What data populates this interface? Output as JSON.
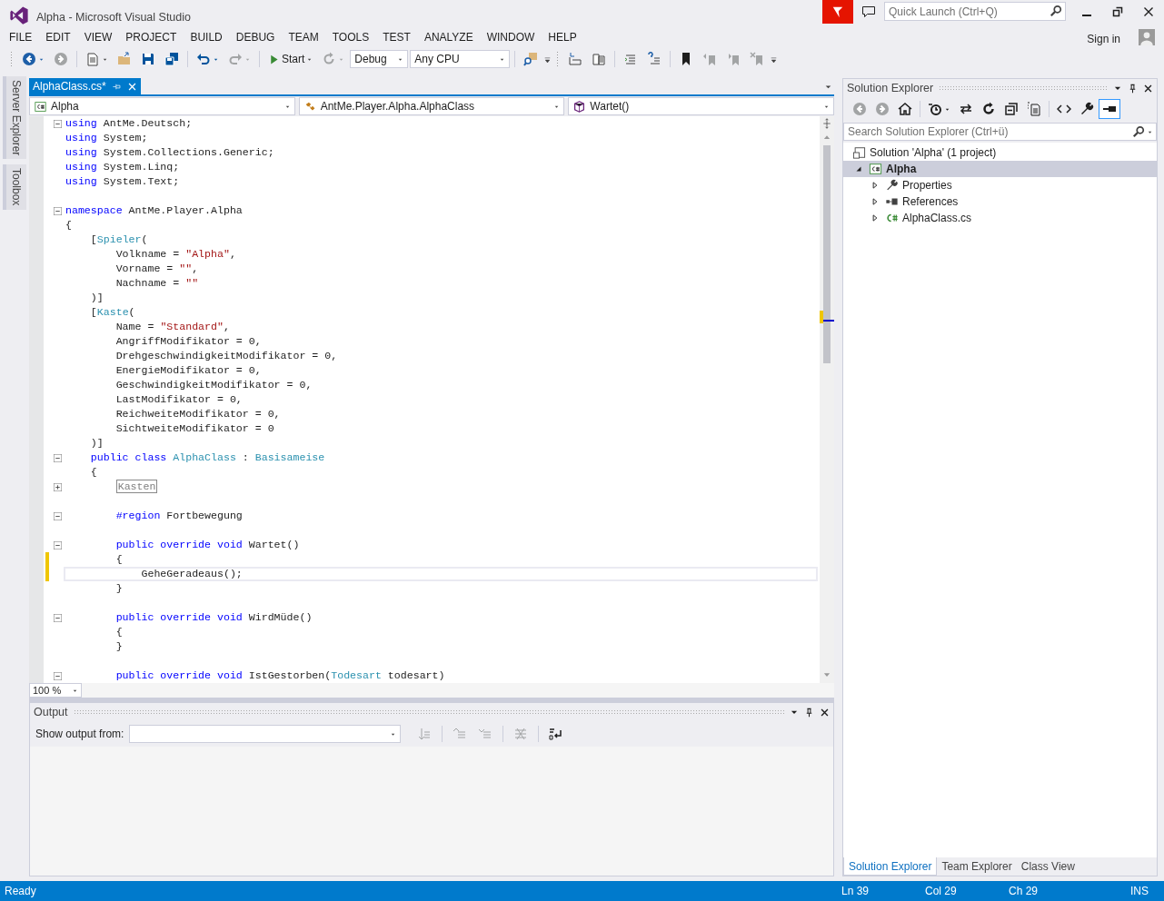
{
  "window": {
    "title": "Alpha - Microsoft Visual Studio",
    "quick_launch": {
      "placeholder": "Quick Launch (Ctrl+Q)"
    },
    "sign_in": "Sign in"
  },
  "menu": [
    "FILE",
    "EDIT",
    "VIEW",
    "PROJECT",
    "BUILD",
    "DEBUG",
    "TEAM",
    "TOOLS",
    "TEST",
    "ANALYZE",
    "WINDOW",
    "HELP"
  ],
  "toolbar": [
    {
      "kind": "grip"
    },
    {
      "kind": "back",
      "disabled": false,
      "dropdown": true
    },
    {
      "kind": "forward",
      "disabled": true,
      "dropdown": false
    },
    {
      "kind": "separator"
    },
    {
      "kind": "new-project",
      "disabled": false,
      "dropdown": true
    },
    {
      "kind": "open",
      "disabled": false,
      "dropdown": false
    },
    {
      "kind": "save",
      "disabled": false,
      "dropdown": false
    },
    {
      "kind": "save-all",
      "disabled": false,
      "dropdown": false
    },
    {
      "kind": "separator"
    },
    {
      "kind": "undo",
      "disabled": false,
      "dropdown": true
    },
    {
      "kind": "redo",
      "disabled": true,
      "dropdown": true
    },
    {
      "kind": "separator"
    },
    {
      "kind": "start",
      "label": "Start",
      "dropdown": true
    },
    {
      "kind": "restart",
      "disabled": true,
      "dropdown": true
    },
    {
      "kind": "combo",
      "value": "Debug"
    },
    {
      "kind": "combo",
      "value": "Any CPU"
    },
    {
      "kind": "separator"
    },
    {
      "kind": "find-in-files",
      "disabled": false,
      "dropdown": false
    },
    {
      "kind": "overflow"
    },
    {
      "kind": "grip"
    },
    {
      "kind": "step-a",
      "disabled": false,
      "dropdown": false
    },
    {
      "kind": "step-b",
      "disabled": false,
      "dropdown": false
    },
    {
      "kind": "separator"
    },
    {
      "kind": "comment",
      "disabled": false,
      "dropdown": false
    },
    {
      "kind": "uncomment",
      "disabled": false,
      "dropdown": false
    },
    {
      "kind": "separator"
    },
    {
      "kind": "bookmark",
      "disabled": false,
      "dropdown": false
    },
    {
      "kind": "bookmark-prev",
      "disabled": true,
      "dropdown": false
    },
    {
      "kind": "bookmark-next",
      "disabled": true,
      "dropdown": false
    },
    {
      "kind": "bookmark-clear",
      "disabled": true,
      "dropdown": false
    },
    {
      "kind": "overflow"
    }
  ],
  "side_tabs": [
    "Server Explorer",
    "Toolbox"
  ],
  "editor": {
    "tabs": [
      {
        "label": "AlphaClass.cs*",
        "selected": true
      }
    ],
    "nav": [
      {
        "kind": "project",
        "value": "Alpha"
      },
      {
        "kind": "class",
        "value": "AntMe.Player.Alpha.AlphaClass"
      },
      {
        "kind": "method",
        "value": "Wartet()"
      }
    ],
    "lines": [
      {
        "collapsed": false,
        "changed": false,
        "current": false,
        "tokens": [
          {
            "kind": "kw",
            "text": "using"
          },
          {
            "kind": "plain",
            "text": " AntMe.Deutsch;"
          }
        ]
      },
      {
        "changed": false,
        "current": false,
        "tokens": [
          {
            "kind": "kw",
            "text": "using"
          },
          {
            "kind": "plain",
            "text": " System;"
          }
        ]
      },
      {
        "changed": false,
        "current": false,
        "tokens": [
          {
            "kind": "kw",
            "text": "using"
          },
          {
            "kind": "plain",
            "text": " System.Collections.Generic;"
          }
        ]
      },
      {
        "changed": false,
        "current": false,
        "tokens": [
          {
            "kind": "kw",
            "text": "using"
          },
          {
            "kind": "plain",
            "text": " System.Linq;"
          }
        ]
      },
      {
        "changed": false,
        "current": false,
        "tokens": [
          {
            "kind": "kw",
            "text": "using"
          },
          {
            "kind": "plain",
            "text": " System.Text;"
          }
        ]
      },
      {
        "changed": false,
        "current": false
      },
      {
        "collapsed": false,
        "changed": false,
        "current": false,
        "tokens": [
          {
            "kind": "kw",
            "text": "namespace"
          },
          {
            "kind": "plain",
            "text": " AntMe.Player.Alpha"
          }
        ]
      },
      {
        "changed": false,
        "current": false,
        "tokens": [
          {
            "kind": "plain",
            "text": "{"
          }
        ]
      },
      {
        "changed": false,
        "current": false,
        "tokens": [
          {
            "kind": "plain",
            "text": "    ["
          },
          {
            "kind": "type",
            "text": "Spieler"
          },
          {
            "kind": "plain",
            "text": "("
          }
        ]
      },
      {
        "changed": false,
        "current": false,
        "tokens": [
          {
            "kind": "plain",
            "text": "        Volkname = "
          },
          {
            "kind": "str",
            "text": "\"Alpha\""
          },
          {
            "kind": "plain",
            "text": ","
          }
        ]
      },
      {
        "changed": false,
        "current": false,
        "tokens": [
          {
            "kind": "plain",
            "text": "        Vorname = "
          },
          {
            "kind": "str",
            "text": "\"\""
          },
          {
            "kind": "plain",
            "text": ","
          }
        ]
      },
      {
        "changed": false,
        "current": false,
        "tokens": [
          {
            "kind": "plain",
            "text": "        Nachname = "
          },
          {
            "kind": "str",
            "text": "\"\""
          }
        ]
      },
      {
        "changed": false,
        "current": false,
        "tokens": [
          {
            "kind": "plain",
            "text": "    )]"
          }
        ]
      },
      {
        "changed": false,
        "current": false,
        "tokens": [
          {
            "kind": "plain",
            "text": "    ["
          },
          {
            "kind": "type",
            "text": "Kaste"
          },
          {
            "kind": "plain",
            "text": "("
          }
        ]
      },
      {
        "changed": false,
        "current": false,
        "tokens": [
          {
            "kind": "plain",
            "text": "        Name = "
          },
          {
            "kind": "str",
            "text": "\"Standard\""
          },
          {
            "kind": "plain",
            "text": ","
          }
        ]
      },
      {
        "changed": false,
        "current": false,
        "tokens": [
          {
            "kind": "plain",
            "text": "        AngriffModifikator = 0,"
          }
        ]
      },
      {
        "changed": false,
        "current": false,
        "tokens": [
          {
            "kind": "plain",
            "text": "        DrehgeschwindigkeitModifikator = 0,"
          }
        ]
      },
      {
        "changed": false,
        "current": false,
        "tokens": [
          {
            "kind": "plain",
            "text": "        EnergieModifikator = 0,"
          }
        ]
      },
      {
        "changed": false,
        "current": false,
        "tokens": [
          {
            "kind": "plain",
            "text": "        GeschwindigkeitModifikator = 0,"
          }
        ]
      },
      {
        "changed": false,
        "current": false,
        "tokens": [
          {
            "kind": "plain",
            "text": "        LastModifikator = 0,"
          }
        ]
      },
      {
        "changed": false,
        "current": false,
        "tokens": [
          {
            "kind": "plain",
            "text": "        ReichweiteModifikator = 0,"
          }
        ]
      },
      {
        "changed": false,
        "current": false,
        "tokens": [
          {
            "kind": "plain",
            "text": "        SichtweiteModifikator = 0"
          }
        ]
      },
      {
        "changed": false,
        "current": false,
        "tokens": [
          {
            "kind": "plain",
            "text": "    )]"
          }
        ]
      },
      {
        "collapsed": false,
        "changed": false,
        "current": false,
        "tokens": [
          {
            "kind": "kw",
            "text": "    public class"
          },
          {
            "kind": "type",
            "text": " AlphaClass"
          },
          {
            "kind": "plain",
            "text": " : "
          },
          {
            "kind": "type",
            "text": "Basisameise"
          }
        ]
      },
      {
        "changed": false,
        "current": false,
        "tokens": [
          {
            "kind": "plain",
            "text": "    {"
          }
        ]
      },
      {
        "collapsed": true,
        "changed": false,
        "current": false,
        "tokens": [
          {
            "kind": "collapsed",
            "text": "Kasten"
          }
        ]
      },
      {
        "changed": false,
        "current": false
      },
      {
        "collapsed": false,
        "changed": false,
        "current": false,
        "tokens": [
          {
            "kind": "kw",
            "text": "        #region"
          },
          {
            "kind": "plain",
            "text": " Fortbewegung"
          }
        ]
      },
      {
        "changed": false,
        "current": false
      },
      {
        "collapsed": false,
        "changed": false,
        "current": false,
        "tokens": [
          {
            "kind": "kw",
            "text": "        public override void"
          },
          {
            "kind": "plain",
            "text": " Wartet()"
          }
        ]
      },
      {
        "changed": true,
        "current": false,
        "tokens": [
          {
            "kind": "plain",
            "text": "        {"
          }
        ]
      },
      {
        "changed": true,
        "current": true,
        "tokens": [
          {
            "kind": "plain",
            "text": "            GeheGeradeaus();"
          }
        ]
      },
      {
        "changed": false,
        "current": false,
        "tokens": [
          {
            "kind": "plain",
            "text": "        }"
          }
        ]
      },
      {
        "changed": false,
        "current": false
      },
      {
        "collapsed": false,
        "changed": false,
        "current": false,
        "tokens": [
          {
            "kind": "kw",
            "text": "        public override void"
          },
          {
            "kind": "plain",
            "text": " WirdMüde()"
          }
        ]
      },
      {
        "changed": false,
        "current": false,
        "tokens": [
          {
            "kind": "plain",
            "text": "        {"
          }
        ]
      },
      {
        "changed": false,
        "current": false,
        "tokens": [
          {
            "kind": "plain",
            "text": "        }"
          }
        ]
      },
      {
        "changed": false,
        "current": false
      },
      {
        "collapsed": false,
        "changed": false,
        "current": false,
        "tokens": [
          {
            "kind": "kw",
            "text": "        public override void"
          },
          {
            "kind": "plain",
            "text": " IstGestorben("
          },
          {
            "kind": "type",
            "text": "Todesart"
          },
          {
            "kind": "plain",
            "text": " todesart)"
          }
        ]
      }
    ],
    "zoom": "100 %"
  },
  "output": {
    "title": "Output",
    "source_label": "Show output from:",
    "toolbar": [
      {
        "kind": "goto-line",
        "disabled": true
      },
      {
        "kind": "separator"
      },
      {
        "kind": "prev-message",
        "disabled": true
      },
      {
        "kind": "next-message",
        "disabled": true
      },
      {
        "kind": "separator"
      },
      {
        "kind": "clear",
        "disabled": true
      },
      {
        "kind": "separator"
      },
      {
        "kind": "word-wrap",
        "disabled": false
      }
    ]
  },
  "solution_explorer": {
    "title": "Solution Explorer",
    "toolbar": [
      {
        "kind": "back",
        "disabled": true
      },
      {
        "kind": "forward",
        "disabled": true
      },
      {
        "kind": "home",
        "disabled": false
      },
      {
        "kind": "separator"
      },
      {
        "kind": "history",
        "disabled": false,
        "dropdown": true
      },
      {
        "kind": "sync",
        "disabled": false
      },
      {
        "kind": "refresh",
        "disabled": false
      },
      {
        "kind": "collapse-all",
        "disabled": false
      },
      {
        "kind": "show-all",
        "disabled": false
      },
      {
        "kind": "separator"
      },
      {
        "kind": "view-code",
        "disabled": false
      },
      {
        "kind": "properties",
        "disabled": false
      },
      {
        "kind": "preview",
        "disabled": false,
        "pressed": true
      }
    ],
    "search": {
      "placeholder": "Search Solution Explorer (Ctrl+ü)"
    },
    "tree": [
      {
        "label": "Solution 'Alpha' (1 project)",
        "kind": "solution",
        "selected": false,
        "children": [
          {
            "label": "Alpha",
            "kind": "project",
            "expanded": true,
            "selected": true,
            "startup": true,
            "children": [
              {
                "label": "Properties",
                "kind": "properties",
                "expanded": false,
                "selected": false
              },
              {
                "label": "References",
                "kind": "references",
                "expanded": false,
                "selected": false
              },
              {
                "label": "AlphaClass.cs",
                "kind": "csfile",
                "expanded": false,
                "selected": false
              }
            ]
          }
        ]
      }
    ],
    "tabs": [
      {
        "label": "Solution Explorer",
        "selected": true
      },
      {
        "label": "Team Explorer",
        "selected": false
      },
      {
        "label": "Class View",
        "selected": false
      }
    ]
  },
  "status_bar": {
    "message": "Ready",
    "line": "Ln 39",
    "column": "Col 29",
    "char": "Ch 29",
    "mode": "INS"
  }
}
